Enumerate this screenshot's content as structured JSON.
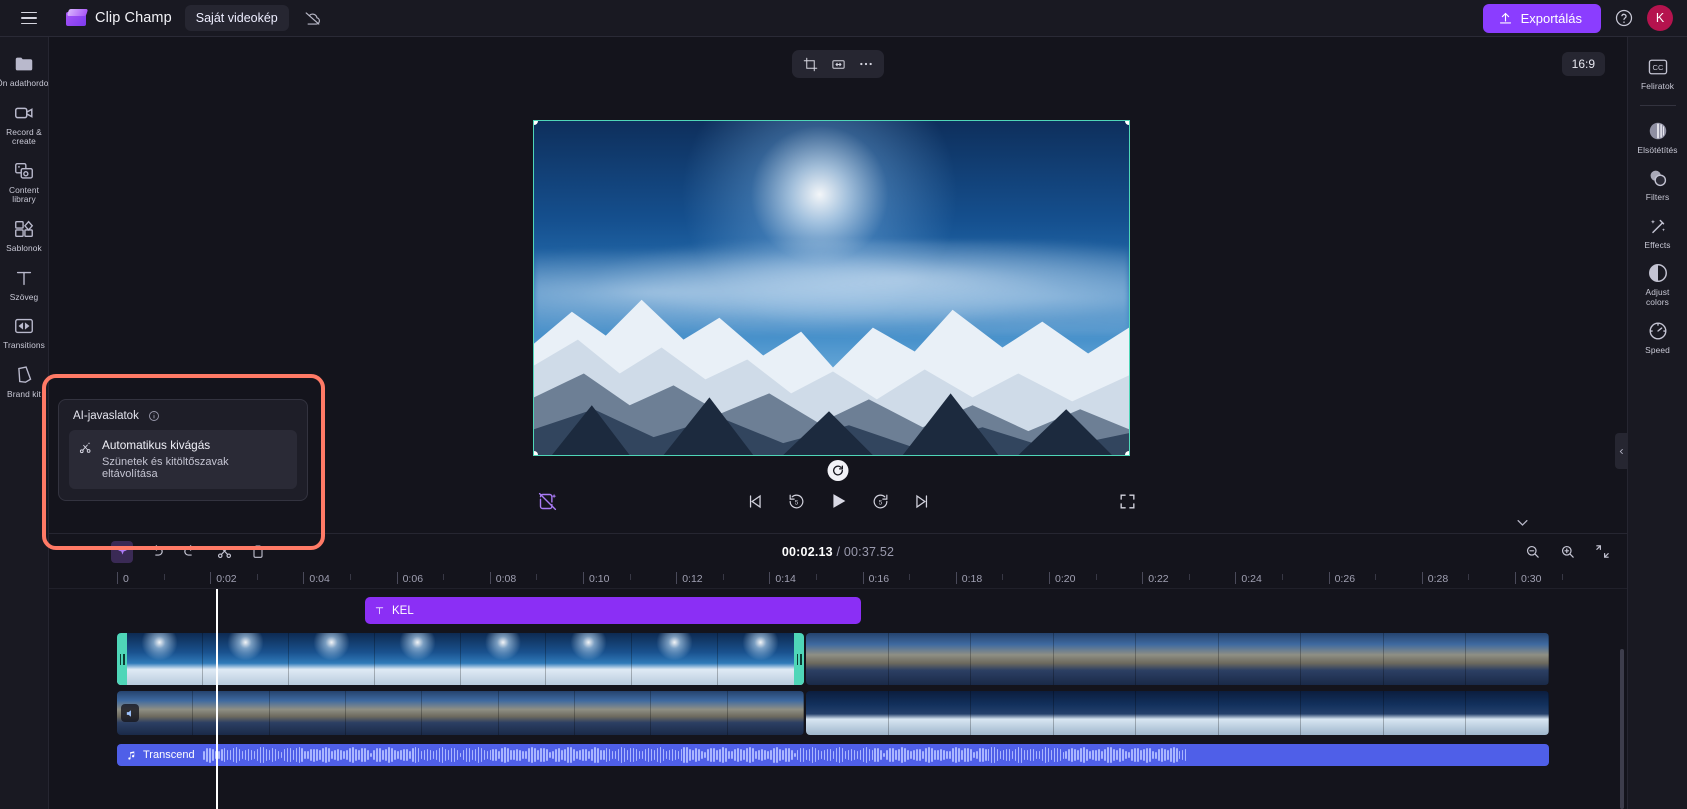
{
  "header": {
    "menu_icon": "hamburger-icon",
    "brand": "Clip Champ",
    "project_tab": "Saját videokép",
    "cloud_icon": "cloud-off-icon",
    "export_label": "Exportálás",
    "help_icon": "help-circle-icon",
    "avatar_initial": "K"
  },
  "left_rail": {
    "items": [
      {
        "label": "Az Ön adathordozója",
        "icon": "folder-icon"
      },
      {
        "label": "Record & create",
        "icon": "camera-icon"
      },
      {
        "label": "Content library",
        "icon": "content-library-icon"
      },
      {
        "label": "Sablonok",
        "icon": "templates-icon"
      },
      {
        "label": "Szöveg",
        "icon": "text-icon"
      },
      {
        "label": "Transitions",
        "icon": "transitions-icon"
      },
      {
        "label": "Brand kit",
        "icon": "brand-kit-icon"
      }
    ]
  },
  "right_rail": {
    "items": [
      {
        "label": "Feliratok",
        "icon": "captions-icon"
      },
      {
        "label": "Elsötétítés",
        "icon": "fade-icon"
      },
      {
        "label": "Filters",
        "icon": "filters-icon"
      },
      {
        "label": "Effects",
        "icon": "effects-icon"
      },
      {
        "label": "Adjust colors",
        "icon": "adjust-colors-icon"
      },
      {
        "label": "Speed",
        "icon": "speed-icon"
      }
    ]
  },
  "preview": {
    "toolbar": [
      {
        "icon": "crop-icon"
      },
      {
        "icon": "fit-icon"
      },
      {
        "icon": "more-options-icon"
      }
    ],
    "aspect_ratio": "16:9",
    "refresh_icon": "refresh-icon",
    "left_tool_icon": "remove-background-icon",
    "controls": [
      {
        "icon": "skip-previous-icon"
      },
      {
        "icon": "rewind-5-icon"
      },
      {
        "icon": "play-icon"
      },
      {
        "icon": "forward-5-icon"
      },
      {
        "icon": "skip-next-icon"
      }
    ],
    "fullscreen_icon": "fullscreen-icon"
  },
  "ai_panel": {
    "title": "AI-javaslatok",
    "info_icon": "info-icon",
    "card": {
      "icon": "auto-cut-icon",
      "title": "Automatikus kivágás",
      "subtitle": "Szünetek és kitöltőszavak eltávolítása"
    },
    "toolbar": [
      {
        "icon": "ai-sparkle-icon"
      },
      {
        "icon": "undo-icon"
      },
      {
        "icon": "redo-icon"
      },
      {
        "icon": "split-icon"
      },
      {
        "icon": "delete-icon"
      }
    ]
  },
  "timeline": {
    "current_time": "00:02.13",
    "separator": " / ",
    "duration": "00:37.52",
    "tools": [
      {
        "icon": "zoom-out-icon"
      },
      {
        "icon": "zoom-in-icon"
      },
      {
        "icon": "fit-timeline-icon"
      }
    ],
    "chevron_icon": "chevron-down-icon",
    "ruler_labels": [
      "0",
      "0:02",
      "0:04",
      "0:06",
      "0:08",
      "0:10",
      "0:12",
      "0:14",
      "0:16",
      "0:18",
      "0:20",
      "0:22",
      "0:24",
      "0:26",
      "0:28",
      "0:30"
    ],
    "playhead_position": "0:02",
    "text_clip": {
      "label": "KEL",
      "icon": "text-icon",
      "color": "#8b2ff5"
    },
    "video_track": {
      "selected": true,
      "trim_icon": "trim-handle-icon"
    },
    "audio_track": {
      "speaker_icon": "speaker-icon"
    },
    "music_clip": {
      "label": "Transcend",
      "icon": "music-note-icon",
      "color": "#4f5fe8"
    }
  },
  "colors": {
    "accent": "#8b3dff",
    "selection": "#4fd6b8",
    "highlight": "#ff7a66",
    "text_clip": "#8b2ff5",
    "audio_clip": "#4f5fe8",
    "avatar": "#b5134e"
  }
}
